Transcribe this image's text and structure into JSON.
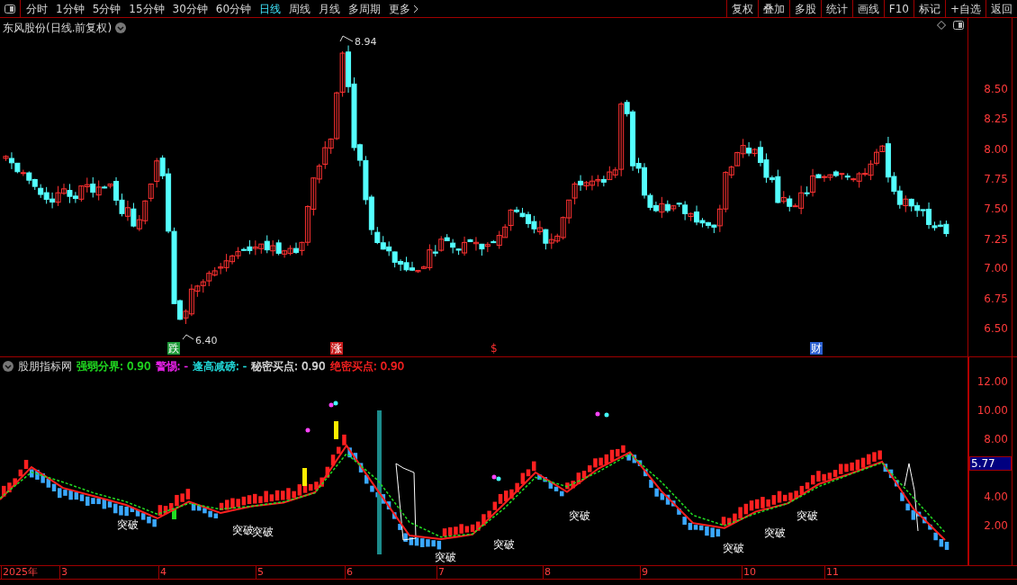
{
  "toolbar": {
    "periods": [
      {
        "label": "分时",
        "selected": false
      },
      {
        "label": "1分钟",
        "selected": false
      },
      {
        "label": "5分钟",
        "selected": false
      },
      {
        "label": "15分钟",
        "selected": false
      },
      {
        "label": "30分钟",
        "selected": false
      },
      {
        "label": "60分钟",
        "selected": false
      },
      {
        "label": "日线",
        "selected": true
      },
      {
        "label": "周线",
        "selected": false
      },
      {
        "label": "月线",
        "selected": false
      },
      {
        "label": "多周期",
        "selected": false
      },
      {
        "label": "更多",
        "selected": false
      }
    ],
    "actions": [
      "复权",
      "叠加",
      "多股",
      "统计",
      "画线",
      "F10",
      "标记",
      "+自选",
      "返回"
    ]
  },
  "main_chart": {
    "title": "东风股份(日线.前复权)",
    "high_label": "8.94",
    "low_label": "6.40",
    "signals": [
      {
        "text": "跌",
        "kind": "box",
        "color": "#1f9a3a"
      },
      {
        "text": "涨",
        "kind": "box",
        "color": "#c81e1e"
      },
      {
        "text": "$",
        "kind": "glyph",
        "color": "#ff3030"
      },
      {
        "text": "财",
        "kind": "box",
        "color": "#2a5fd0"
      }
    ],
    "y_ticks": [
      "8.50",
      "8.25",
      "8.00",
      "7.75",
      "7.50",
      "7.25",
      "7.00",
      "6.75",
      "6.50"
    ]
  },
  "indicator": {
    "name": "股朋指标网",
    "values": [
      {
        "label": "强弱分界:",
        "value": "0.90",
        "color": "#22e022"
      },
      {
        "label": "警惕:",
        "value": "-",
        "color": "#ee22ee"
      },
      {
        "label": "逢高减磅:",
        "value": "-",
        "color": "#22dddd"
      },
      {
        "label": "秘密买点:",
        "value": "0.90",
        "color": "#dddddd"
      },
      {
        "label": "绝密买点:",
        "value": "0.90",
        "color": "#ff2222"
      }
    ],
    "labels": [
      "突破",
      "突破",
      "突破",
      "突破",
      "突破",
      "突破",
      "突破",
      "突破",
      "突破"
    ],
    "chart_data": {
      "type": "line",
      "ylim": [
        -0.75,
        13.69
      ],
      "yticks": [
        {
          "value": 12,
          "label": "12.00"
        },
        {
          "value": 10,
          "label": "10.00"
        },
        {
          "value": 8,
          "label": "8.00"
        },
        {
          "value": 4,
          "label": "4.00"
        },
        {
          "value": 2,
          "label": "2.00"
        }
      ],
      "series": [
        {
          "color": "#ff2020",
          "line_style": "solid",
          "values": [
            3.81,
            6.06,
            4.62,
            4.03,
            3.44,
            2.5,
            3.67,
            2.88,
            3.34,
            3.6,
            4.31,
            7.56,
            4.4,
            1.31,
            1.06,
            1.38,
            3.5,
            5.69,
            4.34,
            5.97,
            7.09,
            4.38,
            2.18,
            1.83,
            2.98,
            3.54,
            4.89,
            5.61,
            6.44,
            3.16,
            1.0
          ]
        },
        {
          "color": "#22dd22",
          "line_style": "dashed",
          "values": [
            3.9,
            5.71,
            5.02,
            4.25,
            3.66,
            2.79,
            3.54,
            3.14,
            3.35,
            3.65,
            4.27,
            7.0,
            5.14,
            2.23,
            1.21,
            1.42,
            3.18,
            5.35,
            4.71,
            5.74,
            6.97,
            5.02,
            2.72,
            2.0,
            2.85,
            3.53,
            4.72,
            5.57,
            6.37,
            3.92,
            1.53
          ]
        }
      ]
    },
    "current": "5.77"
  },
  "date_axis": [
    "2025年",
    "3",
    "4",
    "5",
    "6",
    "7",
    "8",
    "9",
    "10",
    "11"
  ]
}
